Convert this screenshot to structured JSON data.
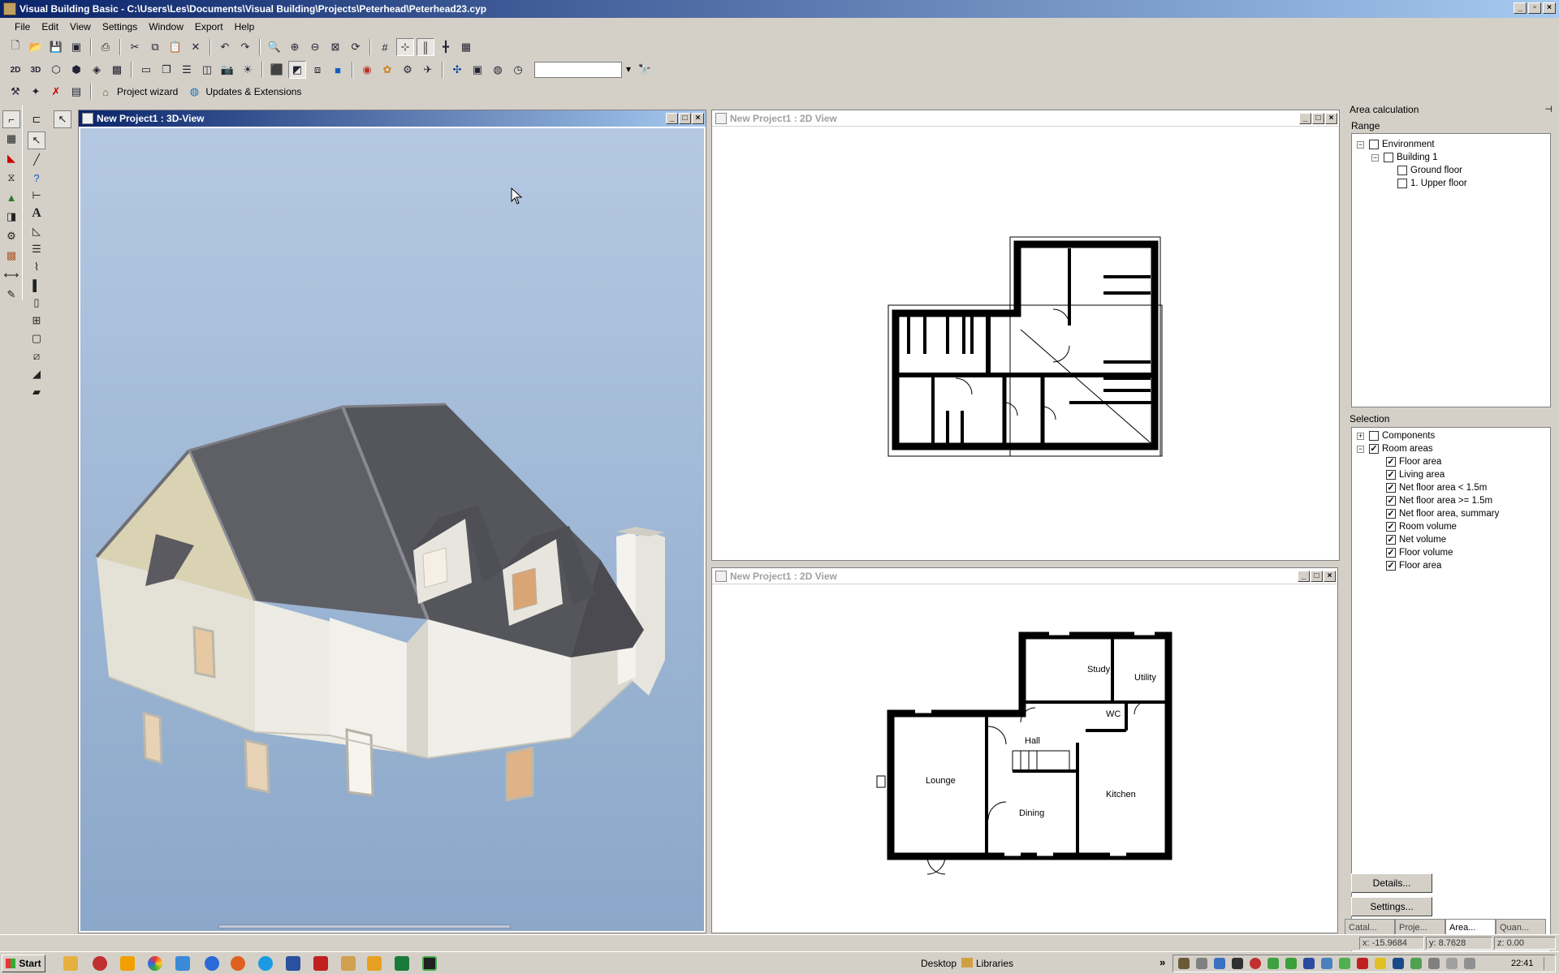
{
  "app": {
    "title": "Visual Building Basic - C:\\Users\\Les\\Documents\\Visual Building\\Projects\\Peterhead\\Peterhead23.cyp"
  },
  "menu": [
    "File",
    "Edit",
    "View",
    "Settings",
    "Window",
    "Export",
    "Help"
  ],
  "toolbar3": {
    "project_wizard": "Project wizard",
    "updates": "Updates & Extensions"
  },
  "windows": {
    "view3d": {
      "title": "New Project1 : 3D-View"
    },
    "plan_upper": {
      "title": "New Project1 : 2D View"
    },
    "plan_ground": {
      "title": "New Project1 : 2D View"
    }
  },
  "ground_floor_rooms": {
    "study": "Study",
    "utility": "Utility",
    "wc": "WC",
    "hall": "Hall",
    "lounge": "Lounge",
    "dining": "Dining",
    "kitchen": "Kitchen"
  },
  "area_panel": {
    "title": "Area calculation",
    "range_label": "Range",
    "range_tree": [
      {
        "label": "Environment",
        "checked": false
      },
      {
        "label": "Building 1",
        "checked": false
      },
      {
        "label": "Ground floor",
        "checked": false
      },
      {
        "label": "1. Upper floor",
        "checked": false
      }
    ],
    "selection_label": "Selection",
    "selection_tree": [
      {
        "label": "Components",
        "checked": false
      },
      {
        "label": "Room areas",
        "checked": true
      },
      {
        "label": "Floor area",
        "checked": true
      },
      {
        "label": "Living area",
        "checked": true
      },
      {
        "label": "Net floor area < 1.5m",
        "checked": true
      },
      {
        "label": "Net floor area >= 1.5m",
        "checked": true
      },
      {
        "label": "Net floor area, summary",
        "checked": true
      },
      {
        "label": "Room volume",
        "checked": true
      },
      {
        "label": "Net volume",
        "checked": true
      },
      {
        "label": "Floor volume",
        "checked": true
      },
      {
        "label": "Floor area",
        "checked": true
      }
    ],
    "details_button": "Details...",
    "settings_button": "Settings...",
    "tabs": [
      "Catal...",
      "Proje...",
      "Area...",
      "Quan..."
    ]
  },
  "status": {
    "x": "x: -15.9684",
    "y": "y: 8.7628",
    "z": "z: 0.00"
  },
  "taskbar": {
    "start": "Start",
    "desktop": "Desktop",
    "libraries": "Libraries",
    "clock": "22:41",
    "chevron": "»"
  }
}
